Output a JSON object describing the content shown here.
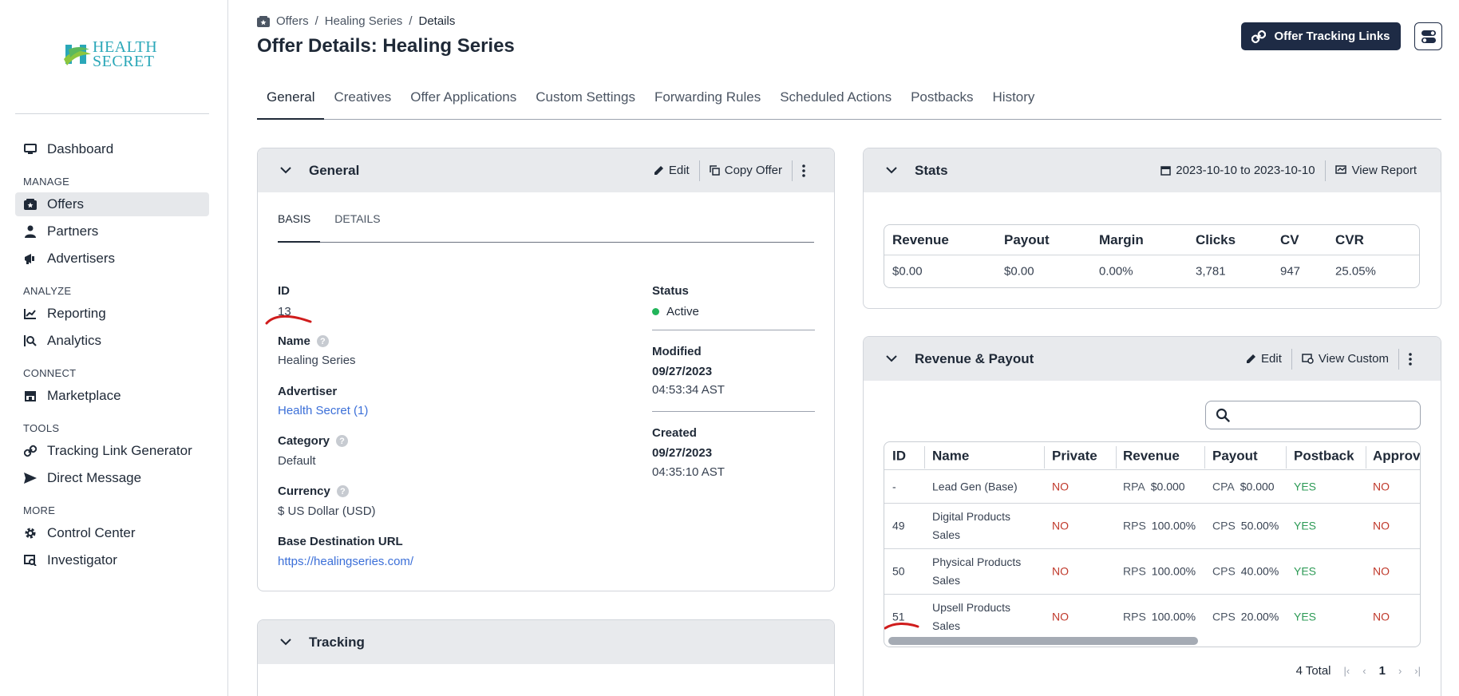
{
  "brand": {
    "logo_line1": "HEALTH",
    "logo_line2": "SECRET"
  },
  "sidebar": {
    "items": [
      {
        "label": "Dashboard"
      },
      {
        "label": "Offers"
      },
      {
        "label": "Partners"
      },
      {
        "label": "Advertisers"
      },
      {
        "label": "Reporting"
      },
      {
        "label": "Analytics"
      },
      {
        "label": "Marketplace"
      },
      {
        "label": "Tracking Link Generator"
      },
      {
        "label": "Direct Message"
      },
      {
        "label": "Control Center"
      },
      {
        "label": "Investigator"
      }
    ],
    "sections": {
      "manage": "MANAGE",
      "analyze": "ANALYZE",
      "connect": "CONNECT",
      "tools": "TOOLS",
      "more": "MORE"
    }
  },
  "header": {
    "breadcrumb": [
      "Offers",
      "Healing Series",
      "Details"
    ],
    "title": "Offer Details: Healing Series",
    "tracking_button": "Offer Tracking Links"
  },
  "tabs": [
    "General",
    "Creatives",
    "Offer Applications",
    "Custom Settings",
    "Forwarding Rules",
    "Scheduled Actions",
    "Postbacks",
    "History"
  ],
  "general": {
    "title": "General",
    "edit": "Edit",
    "copy": "Copy Offer",
    "subtabs": [
      "BASIS",
      "DETAILS"
    ],
    "fields": {
      "id_label": "ID",
      "id_value": "13",
      "name_label": "Name",
      "name_value": "Healing Series",
      "advertiser_label": "Advertiser",
      "advertiser_value": "Health Secret (1)",
      "category_label": "Category",
      "category_value": "Default",
      "currency_label": "Currency",
      "currency_value": "$ US Dollar (USD)",
      "url_label": "Base Destination URL",
      "url_value": "https://healingseries.com/",
      "status_label": "Status",
      "status_value": "Active",
      "modified_label": "Modified",
      "modified_date": "09/27/2023",
      "modified_time": "04:53:34 AST",
      "created_label": "Created",
      "created_date": "09/27/2023",
      "created_time": "04:35:10 AST"
    },
    "status_color": "#22b55a"
  },
  "tracking": {
    "title": "Tracking"
  },
  "stats": {
    "title": "Stats",
    "date_range": "2023-10-10 to 2023-10-10",
    "view_report": "View Report",
    "headers": [
      "Revenue",
      "Payout",
      "Margin",
      "Clicks",
      "CV",
      "CVR"
    ],
    "values": [
      "$0.00",
      "$0.00",
      "0.00%",
      "3,781",
      "947",
      "25.05%"
    ]
  },
  "revenue": {
    "title": "Revenue & Payout",
    "edit": "Edit",
    "view_custom": "View Custom",
    "headers": [
      "ID",
      "Name",
      "Private",
      "Revenue",
      "Payout",
      "Postback",
      "Approv"
    ],
    "rows": [
      {
        "id": "-",
        "name": "Lead Gen (Base)",
        "private": "NO",
        "rev_type": "RPA",
        "rev": "$0.000",
        "pay_type": "CPA",
        "pay": "$0.000",
        "postback": "YES",
        "approve": "NO"
      },
      {
        "id": "49",
        "name": "Digital Products Sales",
        "private": "NO",
        "rev_type": "RPS",
        "rev": "100.00%",
        "pay_type": "CPS",
        "pay": "50.00%",
        "postback": "YES",
        "approve": "NO"
      },
      {
        "id": "50",
        "name": "Physical Products Sales",
        "private": "NO",
        "rev_type": "RPS",
        "rev": "100.00%",
        "pay_type": "CPS",
        "pay": "40.00%",
        "postback": "YES",
        "approve": "NO"
      },
      {
        "id": "51",
        "name": "Upsell Products Sales",
        "private": "NO",
        "rev_type": "RPS",
        "rev": "100.00%",
        "pay_type": "CPS",
        "pay": "20.00%",
        "postback": "YES",
        "approve": "NO"
      }
    ],
    "total": "4 Total",
    "page": "1"
  },
  "colors": {
    "accent": "#1e2b45",
    "link": "#3b6fd8",
    "no": "#c0392b",
    "yes": "#2e9b57",
    "annotation": "#d01c1c"
  }
}
